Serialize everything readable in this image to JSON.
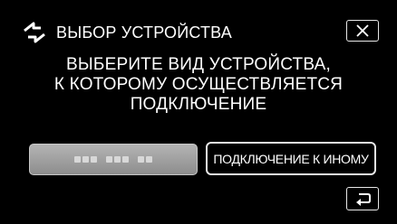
{
  "header": {
    "icon": "connection-arrows-icon",
    "title": "ВЫБОР УСТРОЙСТВА"
  },
  "instruction": {
    "lines": [
      "ВЫБЕРИТЕ ВИД УСТРОЙСТВА,",
      "К КОТОРОМУ ОСУЩЕСТВЛЯЕТСЯ",
      "ПОДКЛЮЧЕНИЕ"
    ]
  },
  "buttons": {
    "close_icon": "close-icon",
    "device_icon": "masked-device-name",
    "other_device_label": "ПОДКЛЮЧЕНИЕ К ИНОМУ",
    "back_icon": "return-arrow-icon"
  },
  "colors": {
    "background": "#000000",
    "text": "#ffffff",
    "button_border": "#e8e8e8",
    "disabled_button": "#a0a0a0"
  }
}
